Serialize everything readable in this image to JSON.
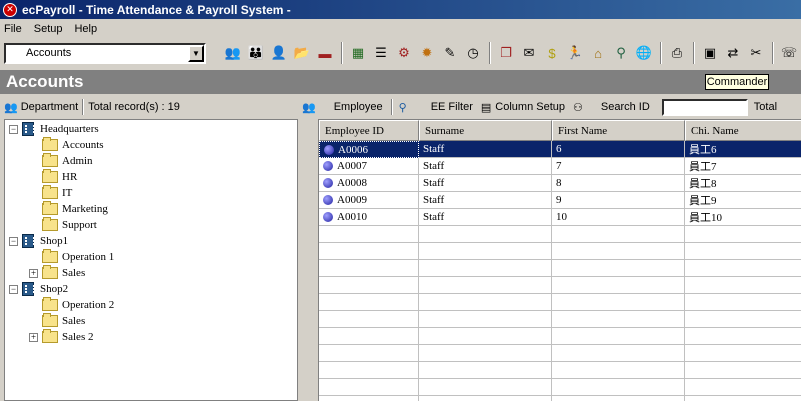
{
  "window": {
    "title": "ecPayroll - Time Attendance & Payroll System -"
  },
  "menu": {
    "items": [
      "File",
      "Setup",
      "Help"
    ]
  },
  "toolbar": {
    "module_select": "Accounts",
    "buttons": [
      "employees-icon",
      "department-icon",
      "user-icon",
      "open-folder-icon",
      "save-icon",
      "calendar-icon",
      "report-icon",
      "settings-icon",
      "gear-icon",
      "tools-icon",
      "clock-icon",
      "copy-icon",
      "mail-icon",
      "money-icon",
      "run-icon",
      "home-icon",
      "globe-user-icon",
      "globe-icon",
      "print-icon",
      "monitor-icon",
      "user-switch-icon",
      "wrench-icon",
      "phone-icon"
    ]
  },
  "header": {
    "title": "Accounts",
    "tooltip": "Commander"
  },
  "left_toolbar": {
    "department_label": "Department",
    "total_records": "Total record(s) : 19"
  },
  "tree": {
    "nodes": [
      {
        "label": "Headquarters",
        "level": 0,
        "type": "building",
        "expander": "−"
      },
      {
        "label": "Accounts",
        "level": 1,
        "type": "folder"
      },
      {
        "label": "Admin",
        "level": 1,
        "type": "folder"
      },
      {
        "label": "HR",
        "level": 1,
        "type": "folder"
      },
      {
        "label": "IT",
        "level": 1,
        "type": "folder"
      },
      {
        "label": "Marketing",
        "level": 1,
        "type": "folder"
      },
      {
        "label": "Support",
        "level": 1,
        "type": "folder"
      },
      {
        "label": "Shop1",
        "level": 0,
        "type": "building",
        "expander": "−"
      },
      {
        "label": "Operation 1",
        "level": 1,
        "type": "folder"
      },
      {
        "label": "Sales",
        "level": 1,
        "type": "folder",
        "expander": "+"
      },
      {
        "label": "Shop2",
        "level": 0,
        "type": "building",
        "expander": "−"
      },
      {
        "label": "Operation 2",
        "level": 1,
        "type": "folder"
      },
      {
        "label": "Sales",
        "level": 1,
        "type": "folder"
      },
      {
        "label": "Sales 2",
        "level": 1,
        "type": "folder",
        "expander": "+"
      }
    ]
  },
  "right_toolbar": {
    "employee_label": "Employee",
    "ee_filter_label": "EE Filter",
    "column_setup_label": "Column Setup",
    "search_id_label": "Search ID",
    "search_value": "",
    "total_label": "Total"
  },
  "grid": {
    "columns": [
      "Employee ID",
      "Surname",
      "First Name",
      "Chi. Name"
    ],
    "rows": [
      {
        "id": "A0006",
        "surname": "Staff",
        "first": "6",
        "chi": "員工6",
        "selected": true
      },
      {
        "id": "A0007",
        "surname": "Staff",
        "first": "7",
        "chi": "員工7",
        "selected": false
      },
      {
        "id": "A0008",
        "surname": "Staff",
        "first": "8",
        "chi": "員工8",
        "selected": false
      },
      {
        "id": "A0009",
        "surname": "Staff",
        "first": "9",
        "chi": "員工9",
        "selected": false
      },
      {
        "id": "A0010",
        "surname": "Staff",
        "first": "10",
        "chi": "員工10",
        "selected": false
      }
    ]
  }
}
